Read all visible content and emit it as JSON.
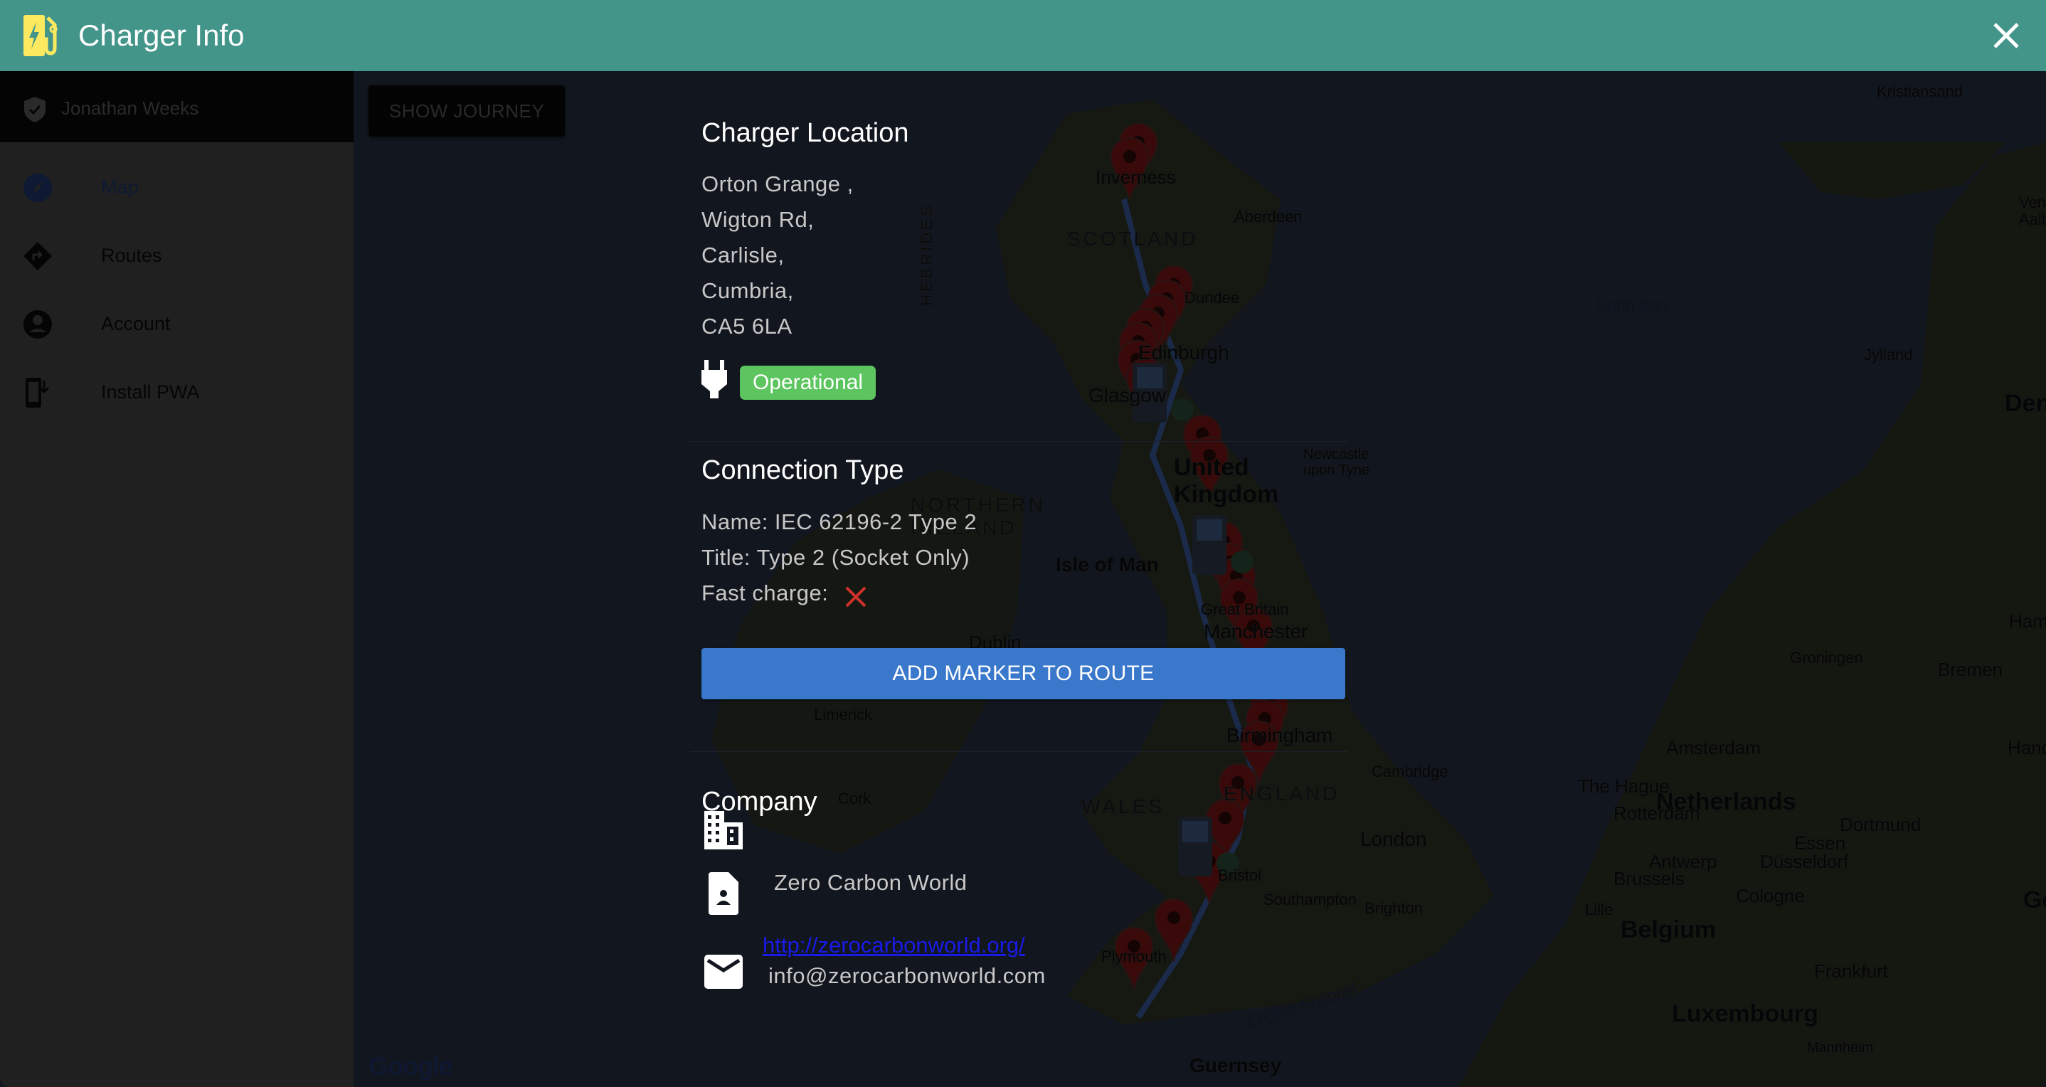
{
  "header": {
    "title": "Charger Info",
    "logo_icon": "ev-station-icon",
    "close_icon": "close-icon",
    "color": "#43958a"
  },
  "sidebar": {
    "user": {
      "name": "Jonathan Weeks",
      "icon": "verified-shield-icon"
    },
    "items": [
      {
        "label": "Map",
        "icon": "compass-icon",
        "active": true
      },
      {
        "label": "Routes",
        "icon": "directions-icon",
        "active": false
      },
      {
        "label": "Account",
        "icon": "account-circle-icon",
        "active": false
      },
      {
        "label": "Install PWA",
        "icon": "install-mobile-icon",
        "active": false
      }
    ]
  },
  "map": {
    "show_journey_label": "SHOW JOURNEY",
    "labels": {
      "inverness": "Inverness",
      "aberdeen": "Aberdeen",
      "scotland": "SCOTLAND",
      "hebrides": "HEBRIDES",
      "dundee": "Dundee",
      "edinburgh": "Edinburgh",
      "glasgow": "Glasgow",
      "united_kingdom": "United Kingdom",
      "newcastle": "Newcastle upon Tyne",
      "northern_ireland": "NORTHERN IRELAND",
      "isle_of_man": "Isle of Man",
      "great_britain": "Great Britain",
      "manchester": "Manchester",
      "dublin": "Dublin",
      "limerick": "Limerick",
      "cork": "Cork",
      "birmingham": "Birmingham",
      "england": "ENGLAND",
      "wales": "WALES",
      "cambridge": "Cambridge",
      "london": "London",
      "bristol": "Bristol",
      "southampton": "Southampton",
      "brighton": "Brighton",
      "plymouth": "Plymouth",
      "english_channel": "English Channel",
      "guernsey": "Guernsey",
      "north_sea": "North Sea",
      "kristiansand": "Kristiansand",
      "jylland": "Jylland",
      "denmark": "Den",
      "groningen": "Groningen",
      "bremen": "Bremen",
      "hamburg": "Ham",
      "amsterdam": "Amsterdam",
      "hanover": "Hano",
      "the_hague": "The Hague",
      "netherlands": "Netherlands",
      "rotterdam": "Rotterdam",
      "dortmund": "Dortmund",
      "essen": "Essen",
      "antwerp": "Antwerp",
      "dusseldorf": "Düsseldorf",
      "brussels": "Brussels",
      "cologne": "Cologne",
      "lille": "Lille",
      "belgium": "Belgium",
      "frankfurt": "Frankfurt",
      "luxembourg": "Luxembourg",
      "mannheim": "Mannheim",
      "germany": "Ge",
      "vendsyssel": "Ven",
      "aalborg": "Aalb"
    },
    "google_logo": "Google"
  },
  "charger": {
    "location_title": "Charger Location",
    "address": [
      "Orton Grange ,",
      "Wigton Rd,",
      "Carlisle,",
      "Cumbria,",
      "CA5 6LA"
    ],
    "status": "Operational",
    "status_color": "#5cc560",
    "connection_title": "Connection Type",
    "connection_name": "Name: IEC 62196-2 Type 2",
    "connection_title_line": "Title: Type 2 (Socket Only)",
    "fast_charge_label": "Fast charge:",
    "fast_charge": false,
    "add_button_label": "ADD MARKER TO ROUTE",
    "company_title": "Company",
    "company_name": "Zero Carbon World",
    "company_url": "http://zerocarbonworld.org/",
    "company_email": "info@zerocarbonworld.com"
  }
}
